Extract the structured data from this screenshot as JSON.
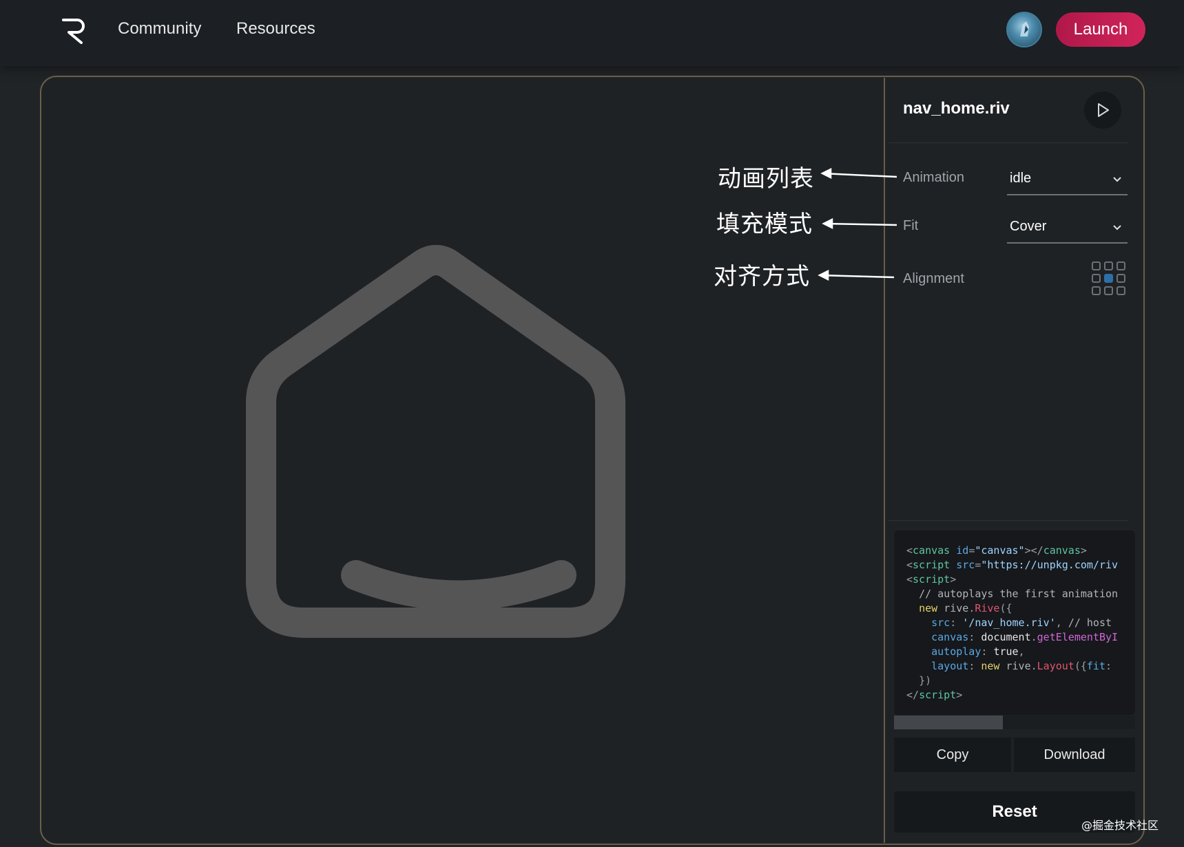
{
  "nav": {
    "links": [
      "Community",
      "Resources"
    ],
    "launch_label": "Launch",
    "icons": [
      "rive-logo-icon",
      "avatar"
    ]
  },
  "annotations": {
    "animation": "动画列表",
    "fit": "填充模式",
    "alignment": "对齐方式"
  },
  "panel": {
    "file_name": "nav_home.riv",
    "play_icon": "play-icon",
    "animation_label": "Animation",
    "animation_value": "idle",
    "fit_label": "Fit",
    "fit_value": "Cover",
    "alignment_label": "Alignment",
    "alignment_selected": "center",
    "copy_label": "Copy",
    "download_label": "Download",
    "reset_label": "Reset",
    "code_scroll_fraction": 0.45
  },
  "watermark": "@掘金技术社区",
  "colors": {
    "background": "#212427",
    "topbar": "#1c1f23",
    "launch": "#c81e52",
    "card_border": "#6b5f48",
    "house_stroke": "#555555",
    "alignment_active": "#2f6fa8"
  }
}
